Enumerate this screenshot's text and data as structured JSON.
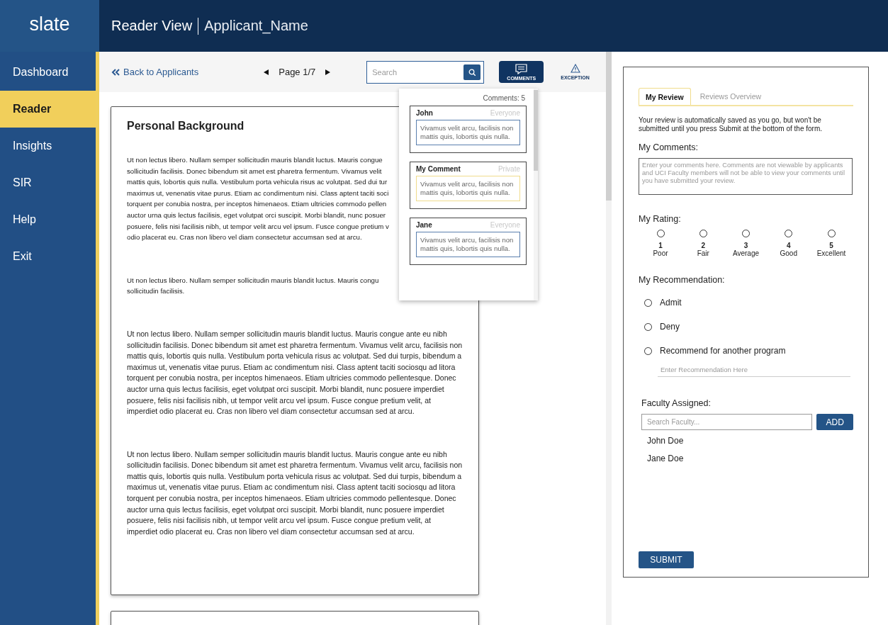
{
  "header": {
    "logo": "slate",
    "title": "Reader View",
    "subtitle": "Applicant_Name"
  },
  "sidebar": {
    "items": [
      {
        "label": "Dashboard",
        "selected": false
      },
      {
        "label": "Reader",
        "selected": true
      },
      {
        "label": "Insights",
        "selected": false
      },
      {
        "label": "SIR",
        "selected": false
      },
      {
        "label": "Help",
        "selected": false
      },
      {
        "label": "Exit",
        "selected": false
      }
    ]
  },
  "toolbar": {
    "back_link": "Back to Applicants",
    "page": "Page 1/7",
    "search": {
      "placeholder": "Search"
    },
    "comments_button": {
      "label": "COMMENTS",
      "selected": true
    },
    "exception_button": {
      "label": "EXCEPTION"
    }
  },
  "document": {
    "heading": "Personal Background",
    "paragraphs": [
      {
        "kind": "cut",
        "lines": [
          "Ut non lectus libero. Nullam semper sollicitudin mauris blandit luctus. Mauris congue",
          "sollicitudin facilisis. Donec bibendum sit amet est pharetra fermentum. Vivamus velit",
          "mattis quis, lobortis quis nulla. Vestibulum porta vehicula risus ac volutpat. Sed dui tur",
          "maximus ut, venenatis vitae purus. Etiam ac condimentum nisi. Class aptent taciti soci",
          "torquent per conubia nostra, per inceptos himenaeos. Etiam ultricies commodo pellen",
          "auctor urna quis lectus facilisis, eget volutpat orci suscipit. Morbi blandit, nunc posuer",
          "posuere, felis nisi facilisis nibh, ut tempor velit arcu vel ipsum. Fusce congue pretium v",
          "odio placerat eu. Cras non libero vel diam consectetur accumsan sed at arcu."
        ]
      },
      {
        "kind": "cut",
        "lines": [
          "Ut non lectus libero. Nullam semper sollicitudin mauris blandit luctus. Mauris congu",
          "sollicitudin facilisis."
        ]
      },
      {
        "kind": "full",
        "text": "Ut non lectus libero. Nullam semper sollicitudin mauris blandit luctus. Mauris congue ante eu nibh sollicitudin facilisis. Donec bibendum sit amet est pharetra fermentum. Vivamus velit arcu, facilisis non mattis quis, lobortis quis nulla. Vestibulum porta vehicula risus ac volutpat. Sed dui turpis, bibendum a maximus ut, venenatis vitae purus. Etiam ac condimentum nisi. Class aptent taciti sociosqu ad litora torquent per conubia nostra, per inceptos himenaeos. Etiam ultricies commodo pellentesque. Donec auctor urna quis lectus facilisis, eget volutpat orci suscipit. Morbi blandit, nunc posuere imperdiet posuere, felis nisi facilisis nibh, ut tempor velit arcu vel ipsum. Fusce congue pretium velit, at imperdiet odio placerat eu. Cras non libero vel diam consectetur accumsan sed at arcu."
      },
      {
        "kind": "full",
        "text": "Ut non lectus libero. Nullam semper sollicitudin mauris blandit luctus. Mauris congue ante eu nibh sollicitudin facilisis. Donec bibendum sit amet est pharetra fermentum. Vivamus velit arcu, facilisis non mattis quis, lobortis quis nulla. Vestibulum porta vehicula risus ac volutpat. Sed dui turpis, bibendum a maximus ut, venenatis vitae purus. Etiam ac condimentum nisi. Class aptent taciti sociosqu ad litora torquent per conubia nostra, per inceptos himenaeos. Etiam ultricies commodo pellentesque. Donec auctor urna quis lectus facilisis, eget volutpat orci suscipit. Morbi blandit, nunc posuere imperdiet posuere, felis nisi facilisis nibh, ut tempor velit arcu vel ipsum. Fusce congue pretium velit, at imperdiet odio placerat eu. Cras non libero vel diam consectetur accumsan sed at arcu."
      }
    ]
  },
  "comments_popup": {
    "count": "Comments: 5",
    "items": [
      {
        "author": "John",
        "visibility": "Everyone",
        "text": "Vivamus velit arcu, facilisis non mattis quis, lobortis quis nulla.",
        "color": "#5a7fae"
      },
      {
        "author": "My Comment",
        "visibility": "Private",
        "text": "Vivamus velit arcu, facilisis non mattis quis, lobortis quis nulla.",
        "color": "#f0dc8c"
      },
      {
        "author": "Jane",
        "visibility": "Everyone",
        "text": "Vivamus velit arcu, facilisis non mattis quis, lobortis quis nulla.",
        "color": "#5a7fae"
      }
    ]
  },
  "review": {
    "tabs": [
      {
        "label": "My Review",
        "selected": true
      },
      {
        "label": "Reviews Overview",
        "selected": false
      }
    ],
    "notice": "Your review is automatically saved as you go, but won't be submitted until you press Submit at the bottom of the form.",
    "comments_label": "My Comments:",
    "comments_placeholder": "Enter your comments here. Comments are not viewable by applicants and UCI Faculty members will not be able to view your comments until you have submitted your review.",
    "rating_label": "My Rating:",
    "ratings": [
      {
        "number": "1",
        "label": "Poor",
        "selected": false
      },
      {
        "number": "2",
        "label": "Fair",
        "selected": false
      },
      {
        "number": "3",
        "label": "Average",
        "selected": false
      },
      {
        "number": "4",
        "label": "Good",
        "selected": false
      },
      {
        "number": "5",
        "label": "Excellent",
        "selected": false
      }
    ],
    "recommendation_label": "My Recommendation:",
    "recommendations": [
      {
        "label": "Admit",
        "selected": false
      },
      {
        "label": "Deny",
        "selected": false
      },
      {
        "label": "Recommend for another program",
        "selected": false
      }
    ],
    "recommendation_placeholder": "Enter Recommendation Here",
    "faculty_label": "Faculty Assigned:",
    "faculty_search": {
      "placeholder": "Search Faculty..."
    },
    "add_button": "ADD",
    "faculty": [
      "John Doe",
      "Jane Doe"
    ],
    "submit_button": "SUBMIT"
  }
}
